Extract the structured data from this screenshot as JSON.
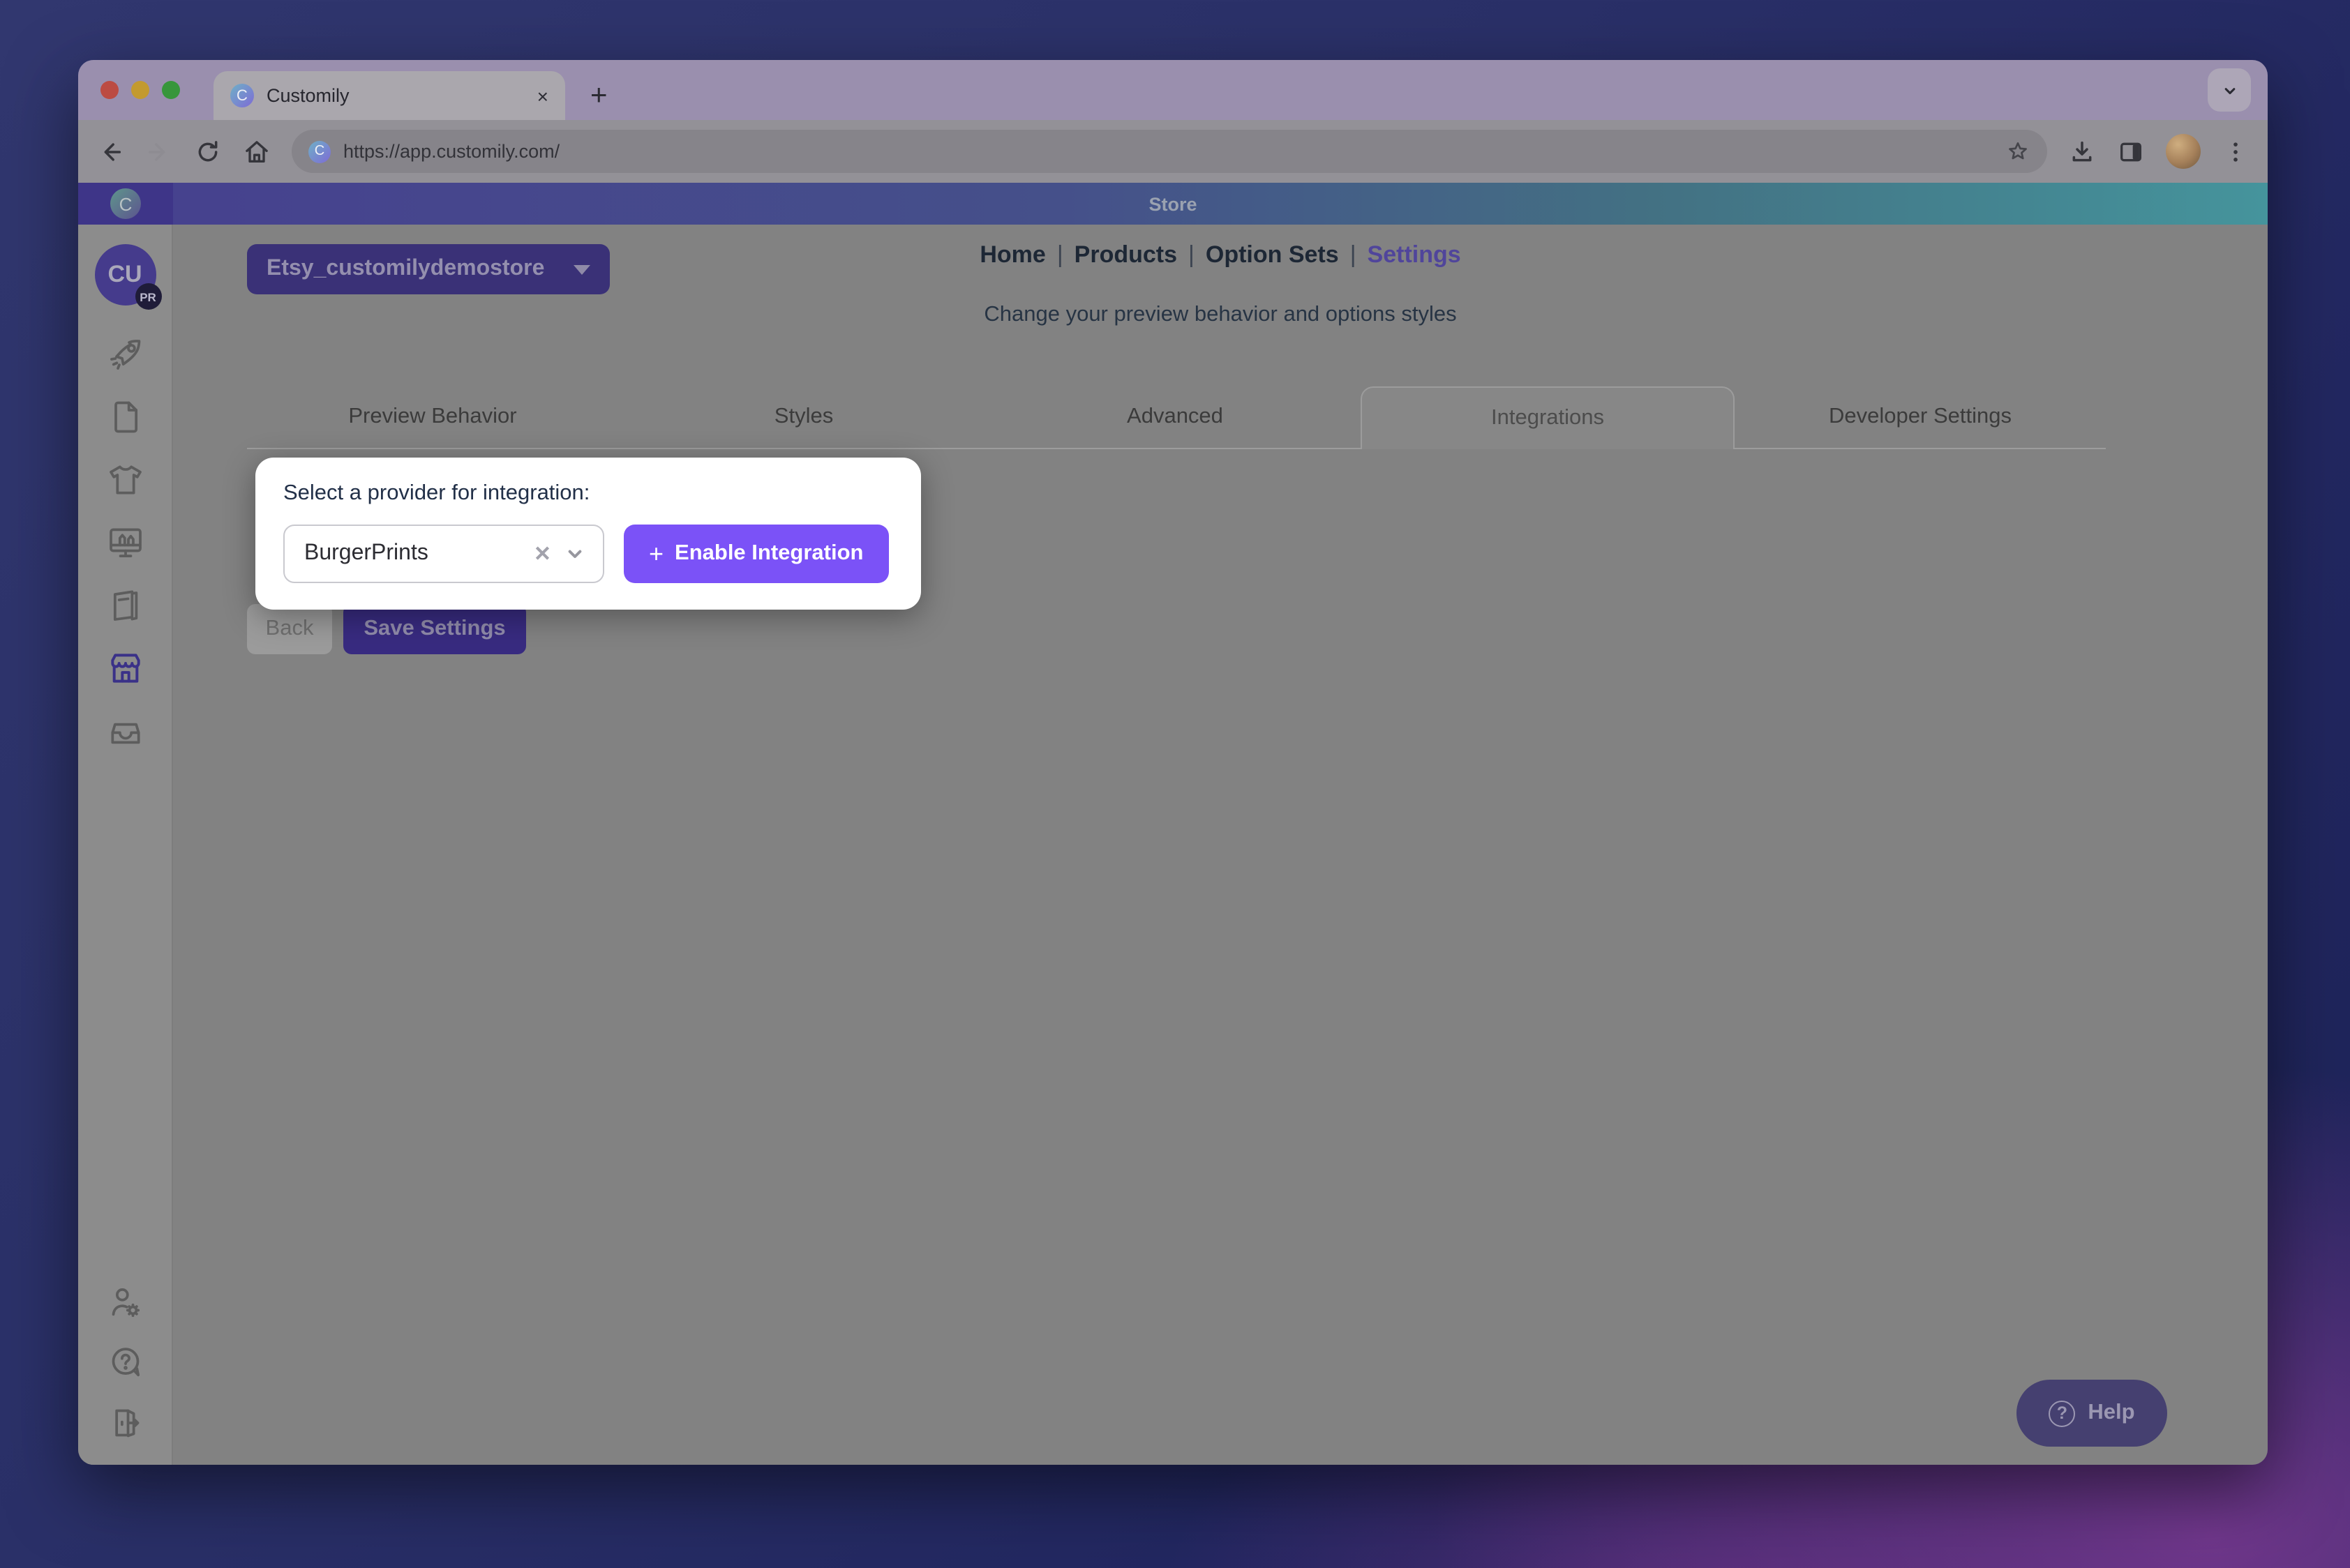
{
  "browser": {
    "tab": {
      "title": "Customily",
      "close_glyph": "×"
    },
    "new_tab_glyph": "+",
    "url": "https://app.customily.com/",
    "favicon_letter": "C"
  },
  "app": {
    "topbar": {
      "title": "Store",
      "logo_letter": "C"
    },
    "store_selector": {
      "value": "Etsy_customilydemostore"
    },
    "nav": {
      "separator": "|",
      "items": [
        {
          "label": "Home"
        },
        {
          "label": "Products"
        },
        {
          "label": "Option Sets"
        },
        {
          "label": "Settings",
          "active": true
        }
      ]
    },
    "subtitle": "Change your preview behavior and options styles",
    "tabs": [
      {
        "label": "Preview Behavior"
      },
      {
        "label": "Styles"
      },
      {
        "label": "Advanced"
      },
      {
        "label": "Integrations",
        "active": true
      },
      {
        "label": "Developer Settings"
      }
    ],
    "integration_card": {
      "label": "Select a provider for integration:",
      "provider_select": {
        "value": "BurgerPrints",
        "clear_glyph": "✕"
      },
      "enable_button": {
        "plus_glyph": "+",
        "label": "Enable Integration"
      }
    },
    "footer_buttons": {
      "back": "Back",
      "save": "Save Settings"
    },
    "help_button": {
      "label": "Help",
      "icon_glyph": "?"
    },
    "sidebar": {
      "avatar": {
        "initials": "CU",
        "badge": "PR"
      },
      "items": [
        {
          "icon": "rocket-icon"
        },
        {
          "icon": "file-icon"
        },
        {
          "icon": "tshirt-icon"
        },
        {
          "icon": "design-monitor-icon"
        },
        {
          "icon": "catalog-icon"
        },
        {
          "icon": "store-icon",
          "active": true
        },
        {
          "icon": "inbox-icon"
        }
      ],
      "footer_items": [
        {
          "icon": "account-settings-icon"
        },
        {
          "icon": "help-bubble-icon"
        },
        {
          "icon": "logout-icon"
        }
      ]
    },
    "colors": {
      "accent_purple": "#7b52f7",
      "brand_purple_dark": "#3e3588",
      "topbar_teal": "#45949c",
      "overlay_dim": "rgba(0,0,0,0.48)"
    }
  }
}
